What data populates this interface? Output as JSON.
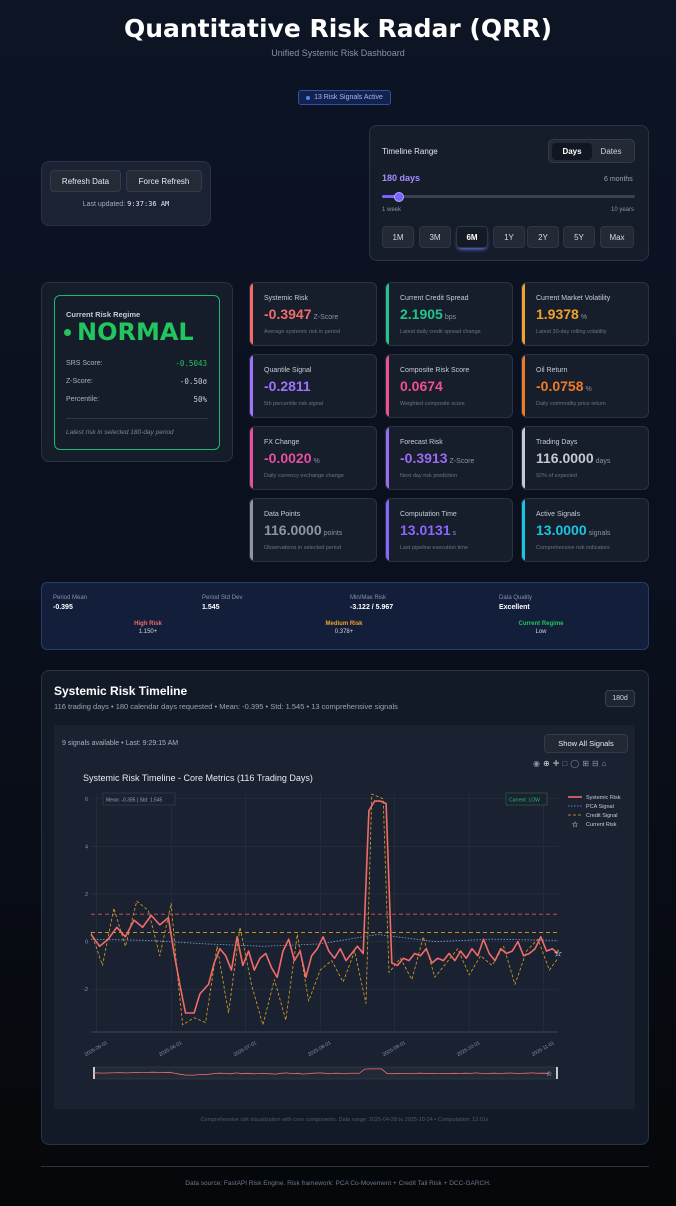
{
  "header": {
    "title": "Quantitative Risk Radar (QRR)",
    "subtitle": "Unified Systemic Risk Dashboard",
    "signals_badge": "13 Risk Signals Active"
  },
  "controls": {
    "refresh_label": "Refresh Data",
    "force_refresh_label": "Force Refresh",
    "last_updated_label": "Last updated:",
    "last_updated_value": "9:37:36 AM"
  },
  "timeline": {
    "label": "Timeline Range",
    "toggle": [
      "Days",
      "Dates"
    ],
    "active_toggle": "Days",
    "days_value": "180 days",
    "months_value": "6 months",
    "slider_fraction": 0.05,
    "min_label": "1 week",
    "max_label": "10 years",
    "presets": [
      "1M",
      "3M",
      "6M",
      "1Y",
      "2Y",
      "5Y",
      "Max"
    ],
    "active_preset": "6M"
  },
  "regime": {
    "heading": "Current Risk Regime",
    "value": "NORMAL",
    "color": "#22c55e",
    "srs_label": "SRS Score:",
    "srs_value": "-0.5043",
    "z_label": "Z-Score:",
    "z_value": "-0.50σ",
    "pct_label": "Percentile:",
    "pct_value": "50%",
    "note": "Latest risk in selected 180-day period"
  },
  "metrics": [
    {
      "label": "Systemic Risk",
      "value": "-0.3947",
      "unit": "Z-Score",
      "desc": "Average systemic risk in period",
      "color": "#f26b6b"
    },
    {
      "label": "Current Credit Spread",
      "value": "2.1905",
      "unit": "bps",
      "desc": "Latest daily credit spread change",
      "color": "#22c58b"
    },
    {
      "label": "Current Market Volatility",
      "value": "1.9378",
      "unit": "%",
      "desc": "Latest 30-day rolling volatility",
      "color": "#f2a22b"
    },
    {
      "label": "Quantile Signal",
      "value": "-0.2811",
      "unit": "",
      "desc": "5th percentile risk signal",
      "color": "#a073ff"
    },
    {
      "label": "Composite Risk Score",
      "value": "0.0674",
      "unit": "",
      "desc": "Weighted composite score",
      "color": "#f0508f"
    },
    {
      "label": "Oil Return",
      "value": "-0.0758",
      "unit": "%",
      "desc": "Daily commodity price return",
      "color": "#f07a25"
    },
    {
      "label": "FX Change",
      "value": "-0.0020",
      "unit": "%",
      "desc": "Daily currency exchange change",
      "color": "#e84fa3"
    },
    {
      "label": "Forecast Risk",
      "value": "-0.3913",
      "unit": "Z-Score",
      "desc": "Next day risk prediction",
      "color": "#9b6cf0"
    },
    {
      "label": "Trading Days",
      "value": "116.0000",
      "unit": "days",
      "desc": "92% of expected",
      "color": "#c4c9d3"
    },
    {
      "label": "Data Points",
      "value": "116.0000",
      "unit": "points",
      "desc": "Observations in selected period",
      "color": "#8d96a6"
    },
    {
      "label": "Computation Time",
      "value": "13.0131",
      "unit": "s",
      "desc": "Last pipeline execution time",
      "color": "#8a66ff"
    },
    {
      "label": "Active Signals",
      "value": "13.0000",
      "unit": "signals",
      "desc": "Comprehensive risk indicators",
      "color": "#19c5df"
    }
  ],
  "stats": {
    "period_mean_label": "Period Mean",
    "period_mean": "-0.395",
    "period_std_label": "Period Std Dev",
    "period_std": "1.545",
    "minmax_label": "Min/Max Risk",
    "minmax": "-3.122 / 5.967",
    "quality_label": "Data Quality",
    "quality": "Excellent",
    "high_label": "High Risk",
    "high_value": "1.150+",
    "medium_label": "Medium Risk",
    "medium_value": "0.378+",
    "current_label": "Current Regime",
    "current_value": "Low"
  },
  "chart_section": {
    "title": "Systemic Risk Timeline",
    "subtitle": "116 trading days • 180 calendar days requested • Mean: -0.395 • Std: 1.545 • 13 comprehensive signals",
    "range_badge": "180d",
    "signals_info": "9 signals available • Last: 9:29:15 AM",
    "show_all_label": "Show All Signals",
    "caption": "Comprehensive risk visualization with core components. Data range: 2025-04-28 to 2025-10-24 • Computation: 13.01s"
  },
  "chart_data": {
    "type": "line",
    "title": "Systemic Risk Timeline - Core Metrics (116 Trading Days)",
    "x_ticks": [
      "2025-05-01",
      "2025-06-01",
      "2025-07-01",
      "2025-08-01",
      "2025-09-01",
      "2025-10-01",
      "2025-11-01"
    ],
    "y_ticks": [
      6,
      4,
      2,
      0,
      -2
    ],
    "ylim": [
      -3.8,
      6.2
    ],
    "xlim": [
      0,
      135
    ],
    "annotation_left": "Mean: -0.395 | Std: 1.545",
    "annotation_right": "Current: LOW",
    "high_threshold": 1.15,
    "medium_threshold": 0.378,
    "legend_position": "top-right",
    "series": [
      {
        "name": "Systemic Risk",
        "color": "#f26b6b",
        "values": [
          [
            0,
            0.3
          ],
          [
            3,
            -0.2
          ],
          [
            6,
            0.1
          ],
          [
            9,
            0.6
          ],
          [
            12,
            0.2
          ],
          [
            15,
            0.9
          ],
          [
            18,
            0.6
          ],
          [
            21,
            1.1
          ],
          [
            24,
            0.7
          ],
          [
            27,
            1.0
          ],
          [
            29,
            -0.5
          ],
          [
            31,
            -1.8
          ],
          [
            33,
            -3.0
          ],
          [
            36,
            -3.0
          ],
          [
            38,
            -2.2
          ],
          [
            41,
            -1.8
          ],
          [
            43,
            -0.9
          ],
          [
            45,
            -0.3
          ],
          [
            47,
            -0.6
          ],
          [
            49,
            -1.2
          ],
          [
            51,
            0.2
          ],
          [
            53,
            -1.0
          ],
          [
            55,
            -0.4
          ],
          [
            57,
            -1.2
          ],
          [
            59,
            -0.7
          ],
          [
            61,
            -0.5
          ],
          [
            63,
            -1.1
          ],
          [
            65,
            -1.5
          ],
          [
            67,
            -0.4
          ],
          [
            69,
            0.1
          ],
          [
            71,
            -0.8
          ],
          [
            73,
            -0.4
          ],
          [
            75,
            -1.5
          ],
          [
            77,
            -0.6
          ],
          [
            79,
            -0.3
          ],
          [
            81,
            0.2
          ],
          [
            83,
            -0.4
          ],
          [
            85,
            -0.7
          ],
          [
            87,
            -0.3
          ],
          [
            89,
            -0.8
          ],
          [
            91,
            -0.5
          ],
          [
            93,
            -0.2
          ],
          [
            95,
            -0.5
          ],
          [
            97,
            5.5
          ],
          [
            99,
            5.9
          ],
          [
            101,
            5.9
          ],
          [
            103,
            5.8
          ],
          [
            105,
            -0.9
          ],
          [
            107,
            -1.0
          ],
          [
            109,
            -0.7
          ],
          [
            111,
            -0.8
          ],
          [
            113,
            -0.5
          ],
          [
            115,
            -0.6
          ],
          [
            117,
            -0.3
          ],
          [
            119,
            -0.9
          ],
          [
            121,
            -0.7
          ],
          [
            123,
            -0.8
          ],
          [
            125,
            -0.5
          ],
          [
            127,
            -0.8
          ],
          [
            129,
            -0.4
          ],
          [
            131,
            -0.7
          ],
          [
            133,
            -0.3
          ],
          [
            135,
            -0.6
          ],
          [
            137,
            0.1
          ],
          [
            139,
            -0.5
          ],
          [
            141,
            -0.8
          ],
          [
            143,
            -0.3
          ],
          [
            145,
            -0.5
          ],
          [
            147,
            -0.4
          ],
          [
            149,
            0.0
          ],
          [
            151,
            -0.6
          ],
          [
            153,
            -0.5
          ],
          [
            155,
            -0.3
          ],
          [
            157,
            0.2
          ],
          [
            159,
            -0.4
          ],
          [
            161,
            -0.3
          ],
          [
            163,
            -0.5
          ]
        ]
      },
      {
        "name": "PCA Signal",
        "color": "#7ea6d6",
        "values": [
          [
            0,
            0.1
          ],
          [
            20,
            0.05
          ],
          [
            40,
            -0.1
          ],
          [
            60,
            -0.2
          ],
          [
            80,
            -0.1
          ],
          [
            100,
            0.3
          ],
          [
            120,
            0.0
          ],
          [
            140,
            0.1
          ],
          [
            163,
            0.05
          ]
        ]
      },
      {
        "name": "Credit Signal",
        "color": "#d9a520",
        "values": [
          [
            0,
            0.4
          ],
          [
            4,
            -1.0
          ],
          [
            8,
            1.4
          ],
          [
            12,
            -0.2
          ],
          [
            16,
            1.7
          ],
          [
            20,
            1.3
          ],
          [
            24,
            -0.6
          ],
          [
            28,
            1.6
          ],
          [
            30,
            -1.2
          ],
          [
            32,
            -3.5
          ],
          [
            36,
            -3.2
          ],
          [
            40,
            -3.4
          ],
          [
            44,
            -0.2
          ],
          [
            48,
            -3.0
          ],
          [
            52,
            0.6
          ],
          [
            56,
            -1.8
          ],
          [
            60,
            -3.5
          ],
          [
            64,
            -1.6
          ],
          [
            68,
            -3.3
          ],
          [
            72,
            0.3
          ],
          [
            76,
            -2.5
          ],
          [
            80,
            -1.2
          ],
          [
            84,
            -0.8
          ],
          [
            88,
            -1.7
          ],
          [
            92,
            -0.4
          ],
          [
            96,
            -2.6
          ],
          [
            98,
            6.2
          ],
          [
            102,
            6.0
          ],
          [
            104,
            -1.3
          ],
          [
            108,
            -0.7
          ],
          [
            112,
            -1.6
          ],
          [
            116,
            0.2
          ],
          [
            120,
            -1.5
          ],
          [
            124,
            -0.9
          ],
          [
            128,
            -0.3
          ],
          [
            132,
            -1.4
          ],
          [
            136,
            -0.6
          ],
          [
            140,
            -1.0
          ],
          [
            144,
            -0.2
          ],
          [
            148,
            -1.8
          ],
          [
            152,
            -0.4
          ],
          [
            156,
            0.1
          ],
          [
            160,
            -1.2
          ],
          [
            163,
            -0.7
          ]
        ]
      }
    ],
    "current_risk": {
      "name": "Current Risk",
      "x": 163,
      "y": -0.5
    }
  },
  "footer": "Data source: FastAPI Risk Engine. Risk framework: PCA Co-Movement + Credit Tail Risk + DCC-GARCH."
}
